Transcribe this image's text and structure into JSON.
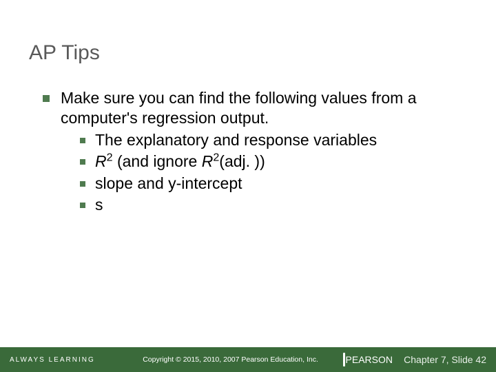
{
  "title": "AP Tips",
  "body": {
    "intro": "Make sure you can find the following values from a computer's regression output.",
    "items": [
      {
        "label": "The explanatory and response variables"
      },
      {
        "r_label_pre": "R",
        "r_label_mid": " (and ignore ",
        "r_label_post": "(adj. ))"
      },
      {
        "label": "slope and y-intercept"
      },
      {
        "label": "s"
      }
    ]
  },
  "footer": {
    "always": "ALWAYS LEARNING",
    "copyright": "Copyright © 2015, 2010, 2007 Pearson Education, Inc.",
    "brand": "PEARSON",
    "chapter": "Chapter 7, Slide 42"
  }
}
